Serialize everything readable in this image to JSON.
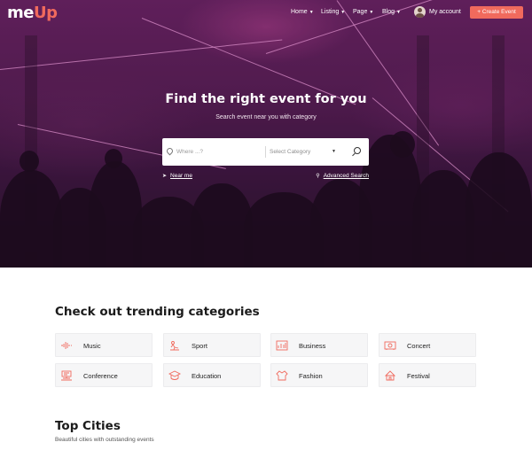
{
  "header": {
    "logo_prefix": "me",
    "logo_accent": "Up",
    "nav": [
      {
        "label": "Home"
      },
      {
        "label": "Listing"
      },
      {
        "label": "Page"
      },
      {
        "label": "Blog"
      }
    ],
    "account_label": "My account",
    "create_event_label": "+ Create Event"
  },
  "hero": {
    "title": "Find the right event for you",
    "subtitle": "Search event near you with category",
    "search": {
      "where_placeholder": "Where ...?",
      "where_value": "",
      "category_placeholder": "Select Category"
    },
    "near_me_label": "Near me",
    "advanced_search_label": "Advanced Search"
  },
  "categories_section": {
    "title": "Check out trending categories",
    "items": [
      {
        "label": "Music",
        "icon": "music-icon"
      },
      {
        "label": "Sport",
        "icon": "sport-icon"
      },
      {
        "label": "Business",
        "icon": "business-icon"
      },
      {
        "label": "Concert",
        "icon": "concert-icon"
      },
      {
        "label": "Conference",
        "icon": "conference-icon"
      },
      {
        "label": "Education",
        "icon": "education-icon"
      },
      {
        "label": "Fashion",
        "icon": "fashion-icon"
      },
      {
        "label": "Festival",
        "icon": "festival-icon"
      }
    ]
  },
  "cities_section": {
    "title": "Top Cities",
    "subtitle": "Beautiful cities with outstanding events"
  },
  "colors": {
    "accent": "#f06a5d",
    "hero_purple": "#6c2466",
    "card_bg": "#f6f6f7"
  }
}
